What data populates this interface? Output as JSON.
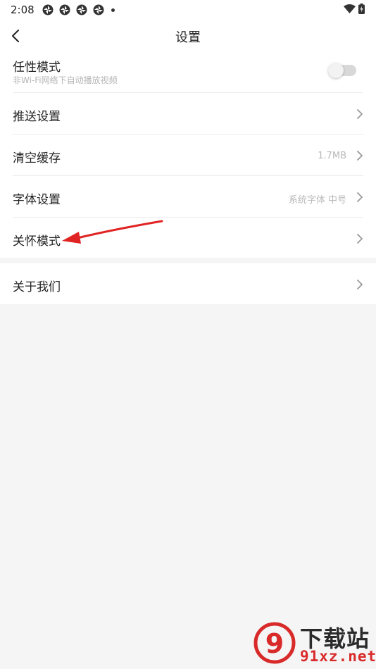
{
  "status_bar": {
    "time": "2:08",
    "app_icons": [
      "shutter-icon",
      "shutter-icon",
      "shutter-icon",
      "shutter-icon"
    ],
    "right_icons": [
      "wifi-icon",
      "battery-charging-icon"
    ]
  },
  "header": {
    "title": "设置",
    "back_icon": "chevron-left-icon"
  },
  "settings": {
    "items": [
      {
        "title": "任性模式",
        "subtitle": "非Wi-Fi网络下自动播放视频",
        "toggle_on": false
      },
      {
        "title": "推送设置"
      },
      {
        "title": "清空缓存",
        "value": "1.7MB"
      },
      {
        "title": "字体设置",
        "value": "系统字体 中号"
      },
      {
        "title": "关怀模式"
      }
    ],
    "about": {
      "title": "关于我们"
    }
  },
  "annotation": {
    "color": "#e02424"
  },
  "watermark": {
    "title": "下载站",
    "site": "91xz.net",
    "logo_text": "9"
  },
  "colors": {
    "background": "#f5f5f5",
    "card": "#ffffff",
    "accent_red": "#d92a2a"
  }
}
